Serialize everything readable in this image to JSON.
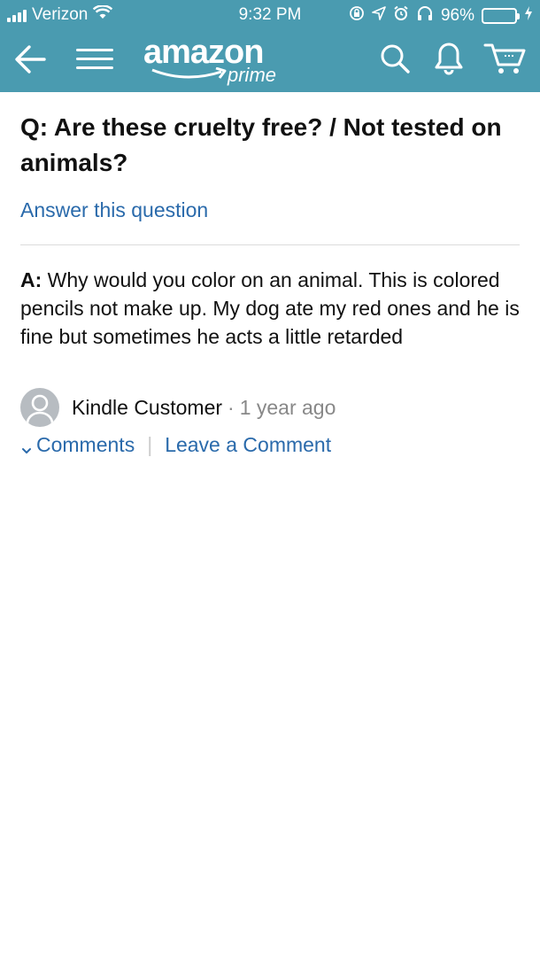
{
  "status_bar": {
    "carrier": "Verizon",
    "time": "9:32 PM",
    "battery_percent": "96%",
    "battery_level": 0.96,
    "icons": [
      "signal-icon",
      "wifi-icon",
      "rotation-lock-icon",
      "location-icon",
      "alarm-icon",
      "headphones-icon",
      "battery-icon",
      "charging-icon"
    ]
  },
  "nav": {
    "logo_word": "amazon",
    "logo_sub": "prime",
    "icons": [
      "back-arrow-icon",
      "menu-icon",
      "search-icon",
      "bell-icon",
      "cart-icon"
    ]
  },
  "question": {
    "prefix": "Q:",
    "text": "Are these cruelty free? / Not tested on animals?"
  },
  "answer_link": "Answer this question",
  "answer": {
    "prefix": "A:",
    "text": "Why would you color on an animal. This is colored pencils not make up. My dog ate my red ones and he is fine but sometimes he acts a little retarded"
  },
  "author": {
    "name": "Kindle Customer",
    "separator": "·",
    "time_ago": "1 year ago"
  },
  "comments": {
    "comments_label": "Comments",
    "divider": "|",
    "leave_label": "Leave a Comment"
  },
  "colors": {
    "header_bg": "#4a9bb0",
    "link": "#2a6aab",
    "battery_fill": "#7ed957"
  }
}
